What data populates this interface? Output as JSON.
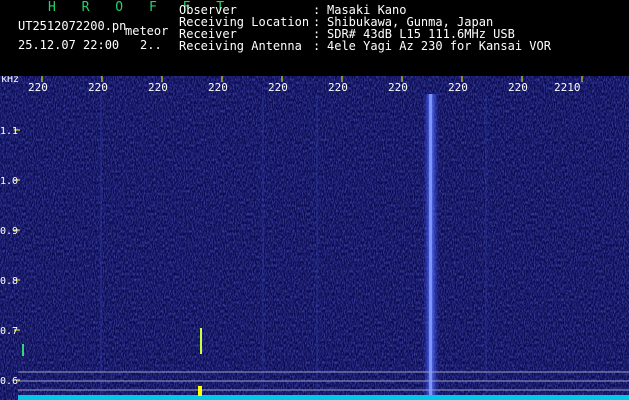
{
  "header": {
    "logo": "H R O F F T",
    "filename": "UT2512072200.pn",
    "tag": "meteor",
    "datetime": "25.12.07 22:00",
    "seq": "2..",
    "meta": [
      {
        "key": "Observer",
        "sep": ":",
        "value": "Masaki Kano"
      },
      {
        "key": "Receiving Location",
        "sep": ":",
        "value": "Shibukawa, Gunma, Japan"
      },
      {
        "key": "Receiver",
        "sep": ":",
        "value": "SDR# 43dB L15 111.6MHz USB"
      },
      {
        "key": "Receiving Antenna",
        "sep": ":",
        "value": "4ele Yagi Az 230 for Kansai VOR"
      }
    ]
  },
  "spectrogram": {
    "y_unit": "kHz",
    "x_ticks": [
      "220",
      "220",
      "220",
      "220",
      "220",
      "220",
      "220",
      "220",
      "220",
      "2210"
    ],
    "y_ticks": [
      "1.1",
      "1.0",
      "0.9",
      "0.8",
      "0.7",
      "0.6"
    ],
    "colors": {
      "background": "#0a0a4a",
      "tick": "#ffff00",
      "grid": "#9aa0c8",
      "trace": "#00e5ff",
      "carrier": "#4a6cff"
    }
  }
}
